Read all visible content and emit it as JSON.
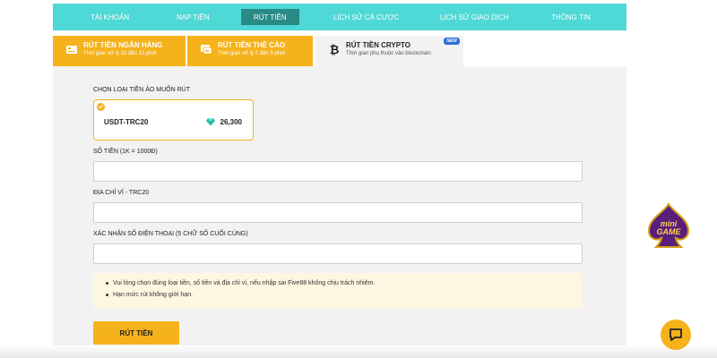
{
  "nav": {
    "items": [
      {
        "label": "TÀI KHOẢN"
      },
      {
        "label": "NẠP TIỀN"
      },
      {
        "label": "RÚT TIỀN"
      },
      {
        "label": "LỊCH SỬ CÁ CƯỢC"
      },
      {
        "label": "LỊCH SỬ GIAO DỊCH"
      },
      {
        "label": "THÔNG TIN"
      }
    ],
    "active_index": 2
  },
  "tabs": [
    {
      "title": "RÚT TIỀN NGÂN HÀNG",
      "subtitle": "Thời gian xử lý 10 đến 12 phút",
      "icon": "bank-icon"
    },
    {
      "title": "RÚT TIỀN THẺ CÀO",
      "subtitle": "Thời gian xử lý 2 đến 5 phút",
      "icon": "card-icon"
    },
    {
      "title": "RÚT TIỀN CRYPTO",
      "subtitle": "Thời gian phụ thuộc vào blockchain",
      "icon": "bitcoin-icon",
      "badge": "NEW"
    }
  ],
  "active_tab": 2,
  "form": {
    "coin_select_label": "CHỌN LOẠI TIỀN ẢO MUỐN RÚT",
    "coin": {
      "name": "USDT-TRC20",
      "balance": "26,300",
      "icon": "gem-icon"
    },
    "amount_label": "SỐ TIỀN (1K = 1000Đ)",
    "amount_value": "",
    "wallet_label": "ĐỊA CHỈ VÍ - TRC20",
    "wallet_value": "",
    "phone_label": "XÁC NHẬN SỐ ĐIỆN THOẠI (5 CHỮ SỐ CUỐI CÙNG)",
    "phone_value": "",
    "notes": [
      "Vui lòng chọn đúng loại tiền, số tiền và địa chỉ ví, nếu nhập sai Five88 không chịu trách nhiệm.",
      "Hạn mức rút không giới hạn."
    ],
    "submit_label": "RÚT TIỀN"
  },
  "widgets": {
    "minigame_icon": "mini-game-icon",
    "chat_icon": "chat-icon"
  },
  "colors": {
    "nav_bg": "#4ed8d6",
    "nav_active": "#2a8a86",
    "accent": "#f5b21a",
    "panel_bg": "#f2f2f2"
  }
}
